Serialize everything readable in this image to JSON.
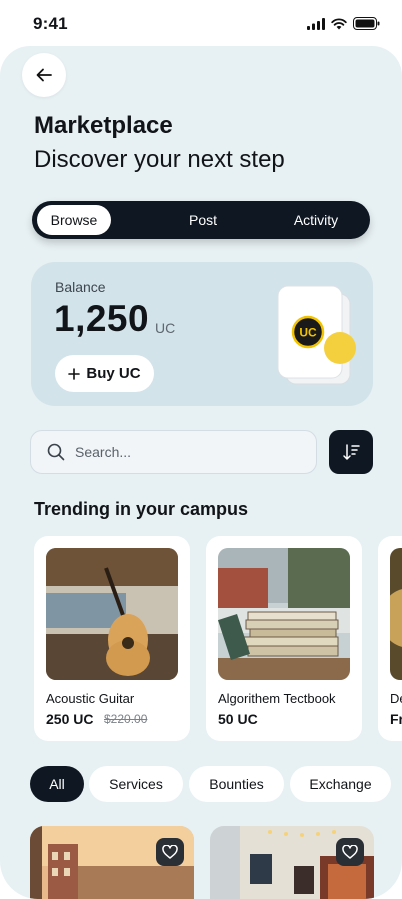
{
  "status": {
    "time": "9:41"
  },
  "header": {
    "title": "Marketplace",
    "subtitle": "Discover your next step"
  },
  "tabs": [
    {
      "label": "Browse",
      "active": true
    },
    {
      "label": "Post",
      "active": false
    },
    {
      "label": "Activity",
      "active": false
    }
  ],
  "balance": {
    "label": "Balance",
    "amount": "1,250",
    "unit": "UC",
    "buy_label": "Buy UC",
    "coin_label": "UC"
  },
  "search": {
    "placeholder": "Search..."
  },
  "trending": {
    "title": "Trending in your campus",
    "items": [
      {
        "name": "Acoustic Guitar",
        "price": "250 UC",
        "old_price": "$220.00"
      },
      {
        "name": "Algorithem Tectbook",
        "price": "50 UC"
      },
      {
        "name": "De",
        "price": "Fr"
      }
    ]
  },
  "filters": [
    {
      "label": "All",
      "active": true
    },
    {
      "label": "Services",
      "active": false
    },
    {
      "label": "Bounties",
      "active": false
    },
    {
      "label": "Exchange",
      "active": false
    }
  ],
  "colors": {
    "accent": "#0f1722",
    "surface": "#e7f0f3",
    "card": "#d2e3e9",
    "coin": "#f4d03f"
  }
}
